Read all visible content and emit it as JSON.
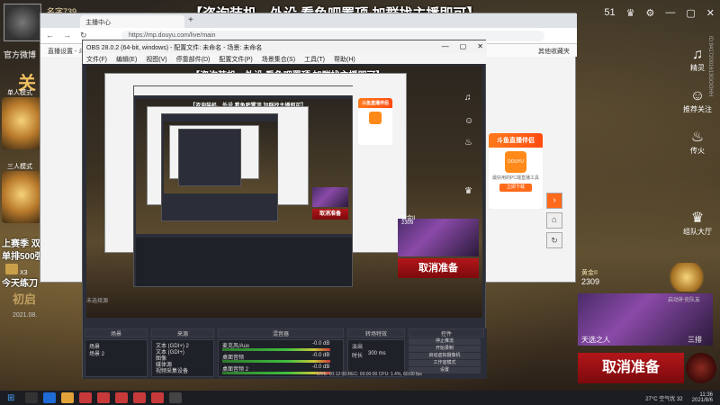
{
  "game": {
    "player_name": "名字739",
    "official_tag": "官方微博",
    "guan_char": "关",
    "mode_single": "单人模式",
    "mode_duo": "三人模式",
    "season_line": "上赛季 双排星",
    "rank_line": "单排500强",
    "x3": "X3",
    "daily": "今天练刀",
    "chubi": "初启",
    "date": "2021.08.",
    "top_banner": "【咨询装机、外设 看鱼吧置顶 加群找主播即可】",
    "right_items": [
      {
        "icon": "♫",
        "label": "精灵"
      },
      {
        "icon": "☺",
        "label": "推荐关注"
      },
      {
        "icon": "♨",
        "label": "传火"
      },
      {
        "icon": "♛",
        "label": "组队大厅"
      }
    ],
    "vertical_id": "ID:94172001613GOOHH",
    "rank_title": "黄金II",
    "rank_num": "2309",
    "rank_queue": "启动补充队友",
    "hero_name": "天选之人",
    "hero_right": "三排",
    "cancel": "取消准备",
    "top_icons": [
      "51",
      "♛",
      "⚙",
      "—",
      "▢",
      "✕"
    ]
  },
  "browser": {
    "tab_title": "主播中心",
    "url": "https://mp.douyu.com/live/main",
    "bookmark_left": "直播设置 - 斗鱼",
    "bookmark_right": "其他收藏夹"
  },
  "obs": {
    "title": "OBS 28.0.2 (64-bit, windows) - 配置文件: 未命名 - 场景: 未命名",
    "menu": [
      "文件(F)",
      "编辑(E)",
      "视图(V)",
      "停靠部件(D)",
      "配置文件(P)",
      "场景集合(S)",
      "工具(T)",
      "帮助(H)"
    ],
    "preview_banner": "【咨询装机、外设 看鱼吧置顶 加群找主播即可】",
    "rm_label": "未选择源",
    "docks": {
      "scenes": "场景",
      "sources": "来源",
      "mixer": "混音器",
      "transitions": "转场特效",
      "controls": "控件"
    },
    "scene_items": [
      "场景",
      "场景 2"
    ],
    "source_items": [
      "文本 (GDI+) 2",
      "文本 (GDI+)",
      "图像",
      "媒体源",
      "视频采集设备"
    ],
    "mixer_items": [
      {
        "label": "麦克风/Aux",
        "db": "-0.0 dB"
      },
      {
        "label": "桌面音频",
        "db": "-0.0 dB"
      },
      {
        "label": "桌面音频 2",
        "db": "-0.0 dB"
      }
    ],
    "transition": {
      "type": "淡出",
      "duration_label": "时长",
      "duration": "300 ms"
    },
    "controls": [
      "停止推流",
      "开始录制",
      "启动虚拟摄像机",
      "工作室模式",
      "设置",
      "退出"
    ],
    "status": "LIVE: 00:12:00   REC: 00:00:00   CPU: 1.4%, 60.00 fps",
    "card_title": "斗鱼直播伴侣",
    "card_text": "最好用的PC端直播工具",
    "card_button": "立即下载",
    "card_logo": "DOUYU"
  },
  "taskbar": {
    "weather": "27°C 空气优 32",
    "time": "11:36",
    "date": "2021/8/6"
  }
}
